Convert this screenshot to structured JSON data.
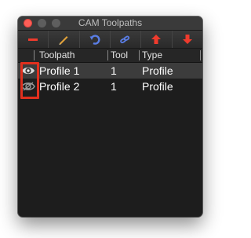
{
  "window": {
    "title": "CAM Toolpaths"
  },
  "toolbar": {
    "buttons": [
      {
        "icon": "minus-icon",
        "color": "#ef3b2d"
      },
      {
        "icon": "pencil-icon",
        "color": "#e0a13a"
      },
      {
        "icon": "refresh-icon",
        "color": "#5a7ee6"
      },
      {
        "icon": "link-icon",
        "color": "#5a7ee6"
      },
      {
        "icon": "arrow-up-icon",
        "color": "#ef3b2d"
      },
      {
        "icon": "arrow-down-icon",
        "color": "#ef3b2d"
      }
    ]
  },
  "table": {
    "columns": [
      "Toolpath",
      "Tool",
      "Type"
    ],
    "rows": [
      {
        "toolpath": "Profile 1",
        "tool": "1",
        "type": "Profile",
        "visible": true
      },
      {
        "toolpath": "Profile 2",
        "tool": "1",
        "type": "Profile",
        "visible": false
      }
    ]
  },
  "colors": {
    "highlight": "#e0301e",
    "selected_row": "#3c3c3c"
  }
}
